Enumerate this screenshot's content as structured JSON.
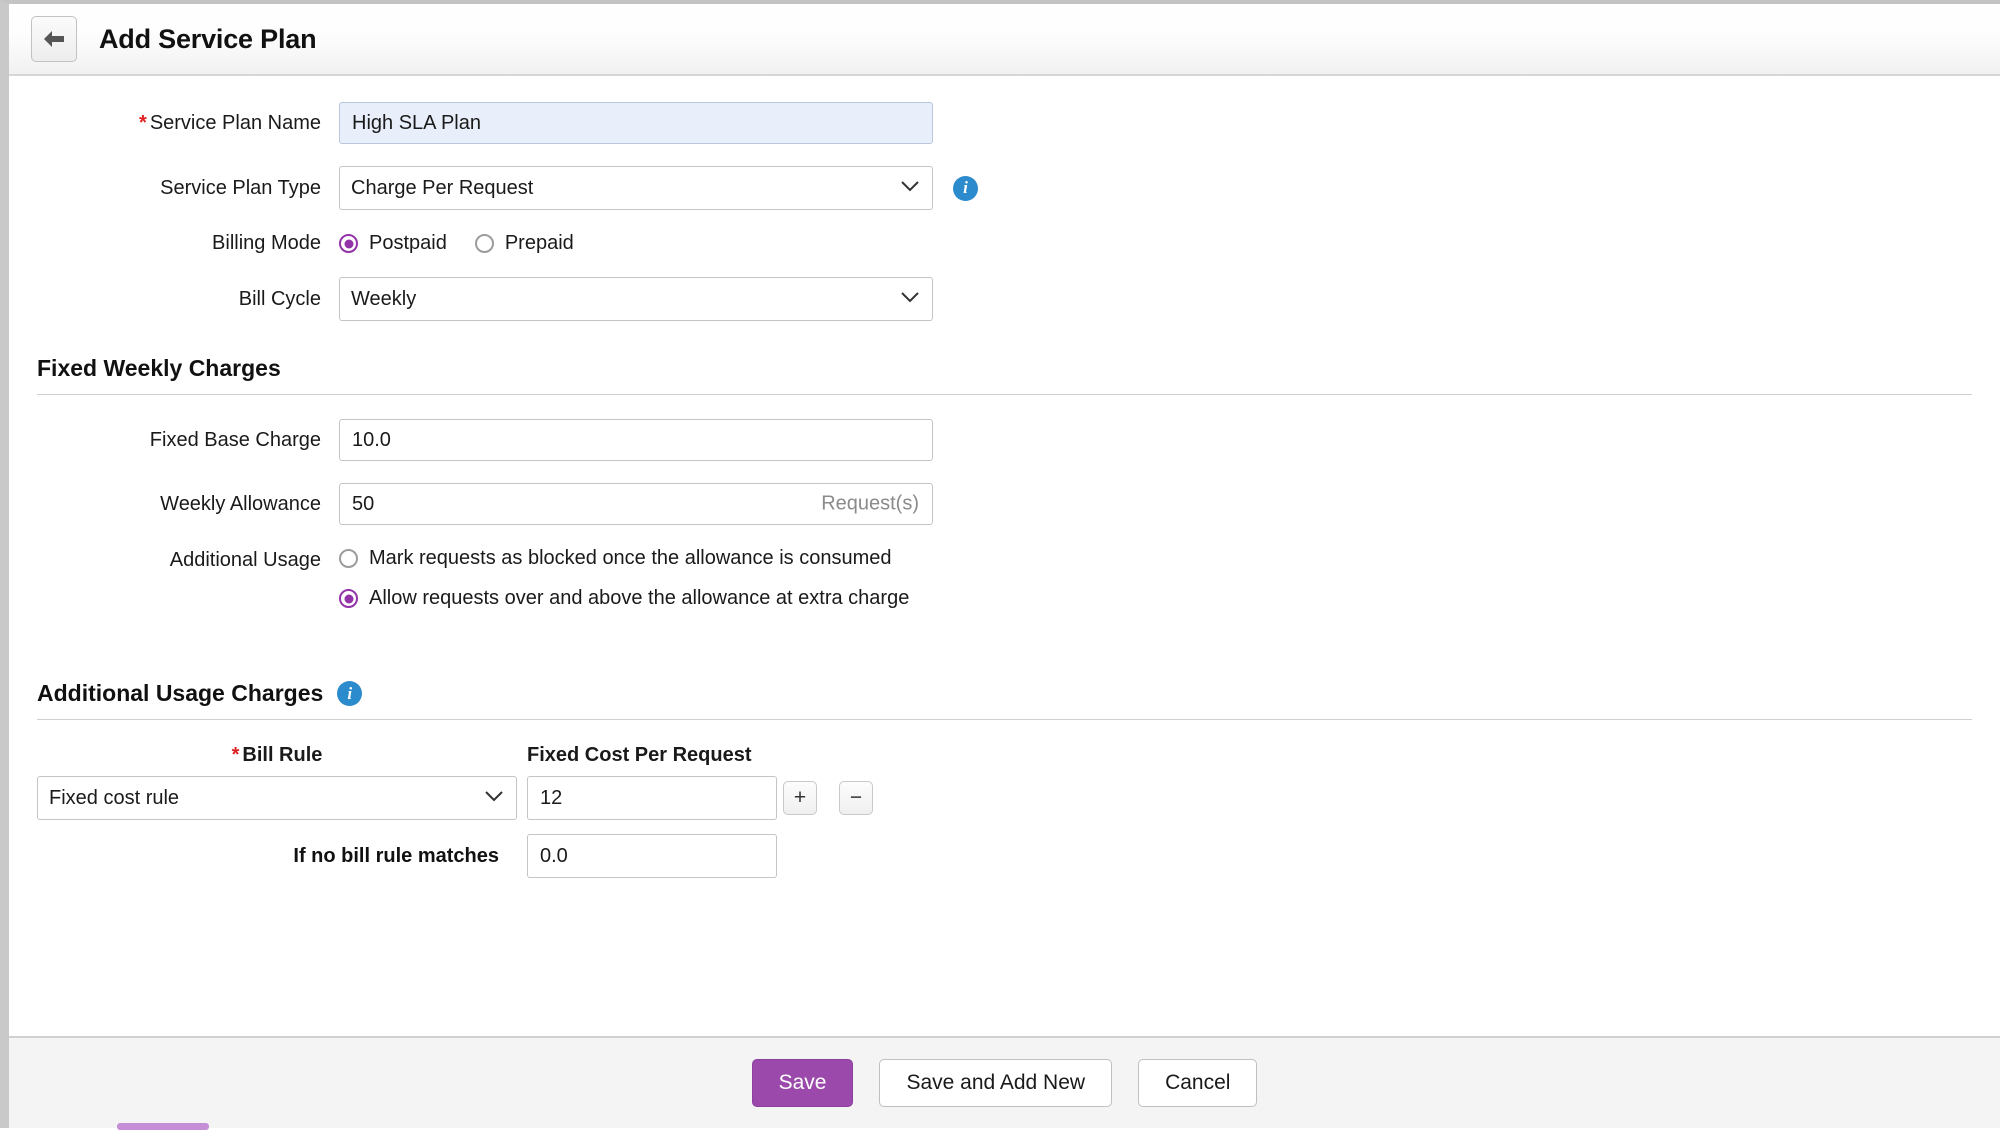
{
  "header": {
    "title": "Add Service Plan",
    "back_icon": "back-arrow-icon"
  },
  "form": {
    "service_plan_name": {
      "label": "Service Plan Name",
      "required_marker": "*",
      "value": "High SLA Plan",
      "placeholder": ""
    },
    "service_plan_type": {
      "label": "Service Plan Type",
      "value": "Charge Per Request",
      "options": [
        "Charge Per Request"
      ],
      "info_icon": "info-icon"
    },
    "billing_mode": {
      "label": "Billing Mode",
      "selected": "Postpaid",
      "options": [
        {
          "label": "Postpaid",
          "selected": true
        },
        {
          "label": "Prepaid",
          "selected": false
        }
      ]
    },
    "bill_cycle": {
      "label": "Bill Cycle",
      "value": "Weekly",
      "options": [
        "Weekly"
      ]
    }
  },
  "fixed_charges": {
    "section_title": "Fixed Weekly Charges",
    "fixed_base_charge": {
      "label": "Fixed Base Charge",
      "value": "10.0"
    },
    "weekly_allowance": {
      "label": "Weekly Allowance",
      "value": "50",
      "suffix": "Request(s)"
    },
    "additional_usage": {
      "label": "Additional Usage",
      "options": [
        {
          "label": "Mark requests as blocked once the allowance is consumed",
          "selected": false
        },
        {
          "label": "Allow requests over and above the allowance at extra charge",
          "selected": true
        }
      ]
    }
  },
  "additional_usage_charges": {
    "section_title": "Additional Usage Charges",
    "info_icon": "info-icon",
    "columns": {
      "bill_rule": "Bill Rule",
      "bill_rule_required": "*",
      "fixed_cost_per_request": "Fixed Cost Per Request"
    },
    "rows": [
      {
        "bill_rule": "Fixed cost rule",
        "bill_rule_options": [
          "Fixed cost rule"
        ],
        "fixed_cost": "12",
        "add_label": "+",
        "remove_label": "−"
      }
    ],
    "no_match": {
      "label": "If no bill rule matches",
      "value": "0.0"
    }
  },
  "footer": {
    "save": "Save",
    "save_and_add_new": "Save and Add New",
    "cancel": "Cancel"
  },
  "colors": {
    "accent_purple": "#9333a8",
    "primary_button": "#9b4aab",
    "info_blue": "#2b8bcc",
    "required_red": "#e02020"
  }
}
